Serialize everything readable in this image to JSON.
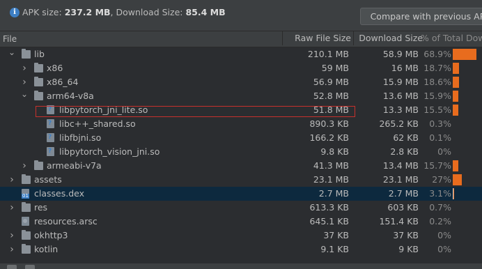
{
  "summary": {
    "apk_label": "APK size: ",
    "apk_value": "237.2 MB",
    "sep": ", Download Size: ",
    "dl_value": "85.4 MB"
  },
  "compare_button": "Compare with previous APK",
  "columns": {
    "file": "File",
    "raw": "Raw File Size",
    "download": "Download Size",
    "percent": "% of Total Download"
  },
  "colors": {
    "bar": "#e86c1e",
    "selected_row": "#0d293e",
    "highlight": "#c8312c"
  },
  "rows": [
    {
      "name": "lib",
      "arrow": "expanded",
      "icon": "folder-icon",
      "raw": "210.1 MB",
      "dl": "58.9 MB",
      "pct": "68.9%",
      "share": 0.689
    },
    {
      "name": "x86",
      "arrow": "collapsed",
      "icon": "folder-icon",
      "raw": "59 MB",
      "dl": "16 MB",
      "pct": "18.7%",
      "share": 0.187
    },
    {
      "name": "x86_64",
      "arrow": "collapsed",
      "icon": "folder-icon",
      "raw": "56.9 MB",
      "dl": "15.9 MB",
      "pct": "18.6%",
      "share": 0.186
    },
    {
      "name": "arm64-v8a",
      "arrow": "expanded",
      "icon": "folder-icon",
      "raw": "52.8 MB",
      "dl": "13.6 MB",
      "pct": "15.9%",
      "share": 0.159
    },
    {
      "name": "libpytorch_jni_lite.so",
      "arrow": "",
      "icon": "so-file-icon",
      "raw": "51.8 MB",
      "dl": "13.3 MB",
      "pct": "15.5%",
      "share": 0.155
    },
    {
      "name": "libc++_shared.so",
      "arrow": "",
      "icon": "so-file-icon",
      "raw": "890.3 KB",
      "dl": "265.2 KB",
      "pct": "0.3%",
      "share": 0.003
    },
    {
      "name": "libfbjni.so",
      "arrow": "",
      "icon": "so-file-icon",
      "raw": "166.2 KB",
      "dl": "62 KB",
      "pct": "0.1%",
      "share": 0.001
    },
    {
      "name": "libpytorch_vision_jni.so",
      "arrow": "",
      "icon": "so-file-icon",
      "raw": "9.8 KB",
      "dl": "2.8 KB",
      "pct": "0%",
      "share": 0
    },
    {
      "name": "armeabi-v7a",
      "arrow": "collapsed",
      "icon": "folder-icon",
      "raw": "41.3 MB",
      "dl": "13.4 MB",
      "pct": "15.7%",
      "share": 0.157
    },
    {
      "name": "assets",
      "arrow": "collapsed",
      "icon": "folder-icon",
      "raw": "23.1 MB",
      "dl": "23.1 MB",
      "pct": "27%",
      "share": 0.27
    },
    {
      "name": "classes.dex",
      "arrow": "",
      "icon": "dex-file-icon",
      "raw": "2.7 MB",
      "dl": "2.7 MB",
      "pct": "3.1%",
      "share": 0.031
    },
    {
      "name": "res",
      "arrow": "collapsed",
      "icon": "folder-icon",
      "raw": "613.3 KB",
      "dl": "603 KB",
      "pct": "0.7%",
      "share": 0.007
    },
    {
      "name": "resources.arsc",
      "arrow": "",
      "icon": "arsc-file-icon",
      "raw": "645.1 KB",
      "dl": "151.4 KB",
      "pct": "0.2%",
      "share": 0.002
    },
    {
      "name": "okhttp3",
      "arrow": "collapsed",
      "icon": "folder-icon",
      "raw": "37 KB",
      "dl": "37 KB",
      "pct": "0%",
      "share": 0
    },
    {
      "name": "kotlin",
      "arrow": "collapsed",
      "icon": "folder-icon",
      "raw": "9.1 KB",
      "dl": "9 KB",
      "pct": "0%",
      "share": 0
    }
  ]
}
